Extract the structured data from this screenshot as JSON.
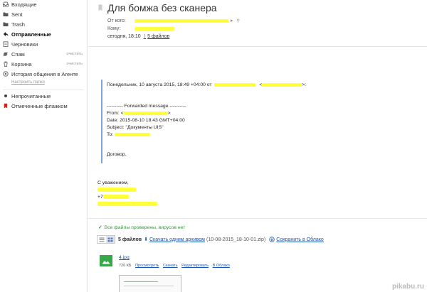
{
  "sidebar": {
    "items": [
      {
        "label": "Входящие",
        "icon": "inbox-icon"
      },
      {
        "label": "Sent",
        "icon": "folder-icon"
      },
      {
        "label": "Trash",
        "icon": "folder-icon"
      },
      {
        "label": "Отправленные",
        "icon": "send-icon"
      },
      {
        "label": "Черновики",
        "icon": "drafts-icon"
      },
      {
        "label": "Спам",
        "icon": "spam-icon",
        "action": "очистить"
      },
      {
        "label": "Корзина",
        "icon": "trash-icon",
        "action": "очистить"
      },
      {
        "label": "История общения в Агенте",
        "icon": "agent-icon"
      }
    ],
    "configure_folders": "Настроить папки",
    "filters": [
      {
        "label": "Непрочитанные",
        "icon": "unread-dot-icon"
      },
      {
        "label": "Отмеченные флажком",
        "icon": "flag-icon"
      }
    ]
  },
  "message": {
    "subject": "Для бомжа без сканера",
    "from_label": "От кого:",
    "to_label": "Кому:",
    "date": "сегодня, 18:10",
    "files_link": "5 файлов"
  },
  "body": {
    "intro": "Понедельник, 10 августа 2015, 18:49 +04:00 от",
    "forwarded_header": "---------- Forwarded message ----------",
    "from_prefix": "From: <",
    "date_line": "Date: 2015-08-10 18:43 GMT+04:00",
    "subject_line": "Subject: \"Документы UIS\"",
    "to_prefix": "To:",
    "contract": "Договор.",
    "regards": "С уважением,",
    "phone_prefix": "+7"
  },
  "attachments": {
    "virus_check": "Все файлы проверены, вирусов нет",
    "count": "5 файлов",
    "download_archive": "Скачать одним архивом",
    "archive_name": "(10-08-2015_18-10-01.zip)",
    "save_to_cloud": "Сохранить в Облако",
    "file": {
      "name": "4.jpg",
      "size": "726 КБ",
      "actions": [
        "Просмотреть",
        "Скачать",
        "Редактировать",
        "В Облако"
      ]
    }
  },
  "watermark": "pikabu.ru",
  "colors": {
    "highlight": "#ffff3a",
    "link": "#1c57b0",
    "virus_ok": "#2f9a37",
    "quote_border": "#7da7d9"
  }
}
